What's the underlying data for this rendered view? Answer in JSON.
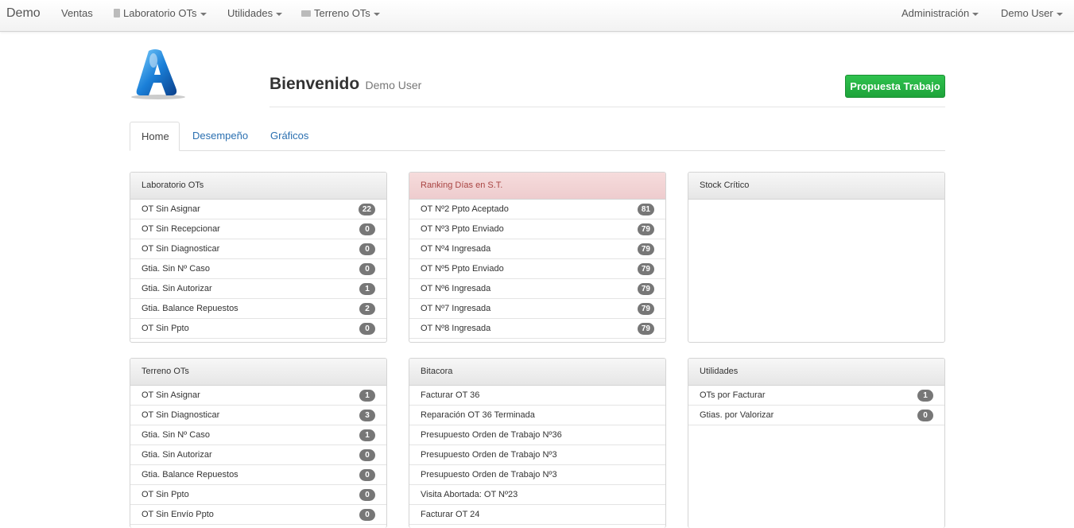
{
  "navbar": {
    "brand": "Demo",
    "items": [
      {
        "label": "Ventas"
      },
      {
        "label": "Laboratorio OTs"
      },
      {
        "label": "Utilidades"
      },
      {
        "label": "Terreno OTs"
      }
    ],
    "right_items": [
      {
        "label": "Administración"
      },
      {
        "label": "Demo User"
      }
    ]
  },
  "header": {
    "welcome": "Bienvenido",
    "user": "Demo User",
    "action_button": "Propuesta Trabajo"
  },
  "tabs": [
    {
      "label": "Home",
      "active": true
    },
    {
      "label": "Desempeño"
    },
    {
      "label": "Gráficos"
    }
  ],
  "colors": {
    "accent_green": "#22a93f",
    "badge_gray": "#777777",
    "alert_header": "#f2d3d3",
    "link_blue": "#2a6fb0"
  },
  "panels": {
    "laboratorio": {
      "title": "Laboratorio OTs",
      "rows": [
        {
          "label": "OT Sin Asignar",
          "count": "22"
        },
        {
          "label": "OT Sin Recepcionar",
          "count": "0"
        },
        {
          "label": "OT Sin Diagnosticar",
          "count": "0"
        },
        {
          "label": "Gtia. Sin Nº Caso",
          "count": "0"
        },
        {
          "label": "Gtia. Sin Autorizar",
          "count": "1"
        },
        {
          "label": "Gtia. Balance Repuestos",
          "count": "2"
        },
        {
          "label": "OT Sin Ppto",
          "count": "0"
        }
      ]
    },
    "ranking": {
      "title": "Ranking Días en S.T.",
      "rows": [
        {
          "label": "OT Nº2 Ppto Aceptado",
          "count": "81"
        },
        {
          "label": "OT Nº3 Ppto Enviado",
          "count": "79"
        },
        {
          "label": "OT Nº4 Ingresada",
          "count": "79"
        },
        {
          "label": "OT Nº5 Ppto Enviado",
          "count": "79"
        },
        {
          "label": "OT Nº6 Ingresada",
          "count": "79"
        },
        {
          "label": "OT Nº7 Ingresada",
          "count": "79"
        },
        {
          "label": "OT Nº8 Ingresada",
          "count": "79"
        }
      ]
    },
    "stock": {
      "title": "Stock Crítico"
    },
    "terreno": {
      "title": "Terreno OTs",
      "rows": [
        {
          "label": "OT Sin Asignar",
          "count": "1"
        },
        {
          "label": "OT Sin Diagnosticar",
          "count": "3"
        },
        {
          "label": "Gtia. Sin Nº Caso",
          "count": "1"
        },
        {
          "label": "Gtia. Sin Autorizar",
          "count": "0"
        },
        {
          "label": "Gtia. Balance Repuestos",
          "count": "0"
        },
        {
          "label": "OT Sin Ppto",
          "count": "0"
        },
        {
          "label": "OT Sin Envío Ppto",
          "count": "0"
        }
      ]
    },
    "bitacora": {
      "title": "Bitacora",
      "rows": [
        {
          "label": "Facturar OT 36"
        },
        {
          "label": "Reparación OT 36 Terminada"
        },
        {
          "label": "Presupuesto Orden de Trabajo Nº36"
        },
        {
          "label": "Presupuesto Orden de Trabajo Nº3"
        },
        {
          "label": "Presupuesto Orden de Trabajo Nº3"
        },
        {
          "label": "Visita Abortada: OT Nº23"
        },
        {
          "label": "Facturar OT 24"
        }
      ]
    },
    "utilidades": {
      "title": "Utilidades",
      "rows": [
        {
          "label": "OTs por Facturar",
          "count": "1"
        },
        {
          "label": "Gtias. por Valorizar",
          "count": "0"
        }
      ]
    }
  }
}
